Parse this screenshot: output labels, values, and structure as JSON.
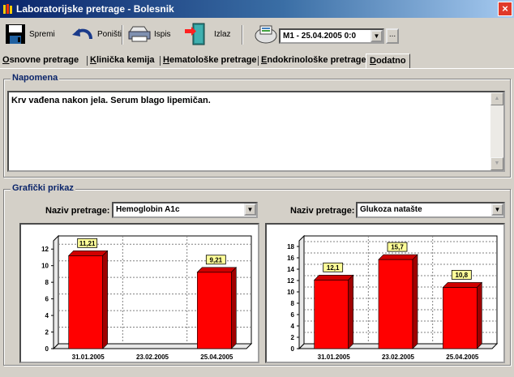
{
  "window": {
    "title": "Laboratorijske pretrage - Bolesnik",
    "close_glyph": "×"
  },
  "toolbar": {
    "save_label": "Spremi",
    "undo_label": "Poništi",
    "print_label": "Ispis",
    "exit_label": "Izlaz",
    "record_select": "M1 - 25.04.2005 0:0",
    "more_label": "...",
    "icons": [
      "floppy-disk-icon",
      "undo-arrow-icon",
      "printer-icon",
      "exit-door-icon",
      "lab-device-icon"
    ]
  },
  "tabs": [
    {
      "label": "Osnovne pretrage",
      "active": false
    },
    {
      "label": "Klinička kemija",
      "active": false
    },
    {
      "label": "Hematološke pretrage",
      "active": false
    },
    {
      "label": "Endokrinološke pretrage",
      "active": false
    },
    {
      "label": "Dodatno",
      "active": true
    }
  ],
  "note_group": {
    "caption": "Napomena",
    "text": "Krv vađena nakon jela. Serum blago lipemičan."
  },
  "chart_group": {
    "caption": "Grafički prikaz",
    "left_select_label": "Naziv pretrage:",
    "left_select_value": "Hemoglobin A1c",
    "right_select_label": "Naziv pretrage:",
    "right_select_value": "Glukoza natašte"
  },
  "colors": {
    "bar_front": "#ff0000",
    "bar_side": "#a00000",
    "bar_top": "#d00000",
    "data_label_bg": "#ffff99",
    "caption": "#0a246a"
  },
  "chart_data": [
    {
      "type": "bar",
      "categories": [
        "31.01.2005",
        "23.02.2005",
        "25.04.2005"
      ],
      "values": [
        11.21,
        null,
        9.21
      ],
      "data_labels": [
        "11,21",
        "",
        "9,21"
      ],
      "yticks": [
        "0",
        "2",
        "4",
        "6",
        "8",
        "10",
        "12"
      ],
      "ylim": [
        0,
        13
      ],
      "grid": true
    },
    {
      "type": "bar",
      "categories": [
        "31.01.2005",
        "23.02.2005",
        "25.04.2005"
      ],
      "values": [
        12.1,
        15.7,
        10.8
      ],
      "data_labels": [
        "12,1",
        "15,7",
        "10,8"
      ],
      "yticks": [
        "0",
        "2",
        "4",
        "6",
        "8",
        "10",
        "12",
        "14",
        "16",
        "18"
      ],
      "ylim": [
        0,
        19
      ],
      "grid": true
    }
  ]
}
